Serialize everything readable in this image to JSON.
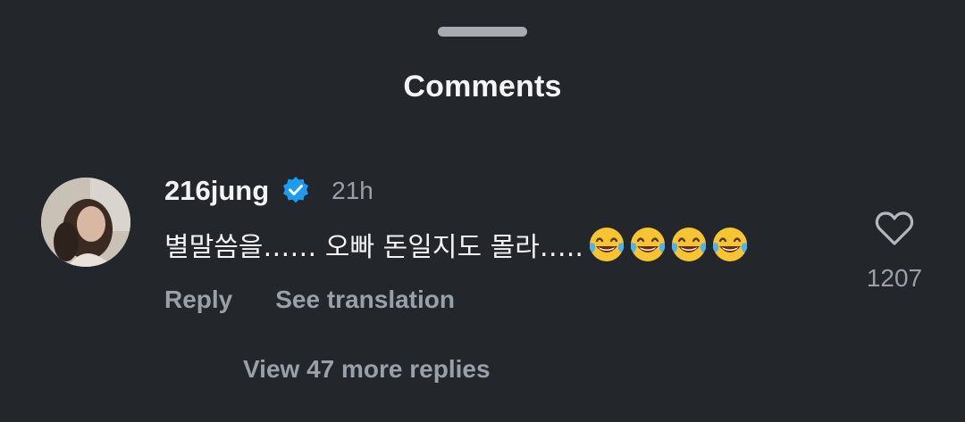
{
  "sheet": {
    "title": "Comments"
  },
  "comment": {
    "username": "216jung",
    "verified": true,
    "timestamp": "21h",
    "text": "별말씀을…… 오빠 돈일지도 몰라…..",
    "emojis": [
      "face-with-tears-of-joy",
      "face-with-tears-of-joy",
      "face-with-tears-of-joy",
      "face-with-tears-of-joy"
    ],
    "actions": {
      "reply_label": "Reply",
      "translate_label": "See translation"
    },
    "likes": {
      "count": "1207",
      "icon": "heart-outline-icon"
    },
    "replies_label": "View 47 more replies"
  },
  "colors": {
    "background": "#23262b",
    "primary_text": "#f2f3f5",
    "secondary_text": "#9aa0a8",
    "verified_badge": "#1d9bf0",
    "handle": "#a8acb2"
  }
}
